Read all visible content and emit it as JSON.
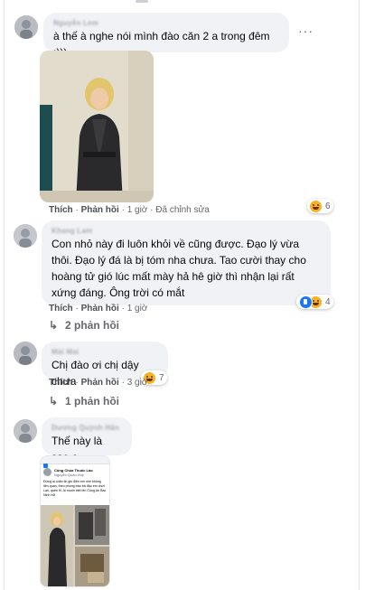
{
  "comments": [
    {
      "name": "Nguyễn Lem",
      "text": "à thế à nghe nói mình đào căn 2 a trong đêm :)))",
      "like": "Thích",
      "reply": "Phản hồi",
      "time": "1 giờ",
      "edited": "Đã chỉnh sửa",
      "reaction_count": "6"
    },
    {
      "name": "Khang Lam",
      "text": "Con nhỏ này đi luôn khỏi về cũng được. Đạo lý vừa thôi. Đạo lý đá là bị tóm nha chưa. Tao cười thay cho hoàng tử gió lúc mất mày hả hê giờ thì nhận lại rất xứng đáng. Ông trời có mắt",
      "like": "Thích",
      "reply": "Phản hồi",
      "time": "1 giờ",
      "reaction_count": "4",
      "replies": "2 phản hồi"
    },
    {
      "name": "Mái Mai",
      "text": "Chị đào ơi chị dậy chưa",
      "like": "Thích",
      "reply": "Phản hồi",
      "time": "3 giờ",
      "reaction_count": "7",
      "replies": "1 phản hồi"
    },
    {
      "name": "Dương Quỳnh Hân",
      "text": "Thế này là sao e",
      "screenshot": {
        "header_line1": "Công Chúa Thuốc Lào",
        "header_line2": "Nguyễn Quân Huy",
        "body": "Đừng ai chăn tin gió điện em nhé không liên quan, theo phong trào bà đào em chơi Lan, quên hi. Ai muốn biết lên Công An Bac Ninh hỏi"
      }
    }
  ],
  "colors": {
    "bubble": "#f0f2f5",
    "meta": "#65676b",
    "like_blue": "#1877f2",
    "haha": "#f7b125"
  }
}
